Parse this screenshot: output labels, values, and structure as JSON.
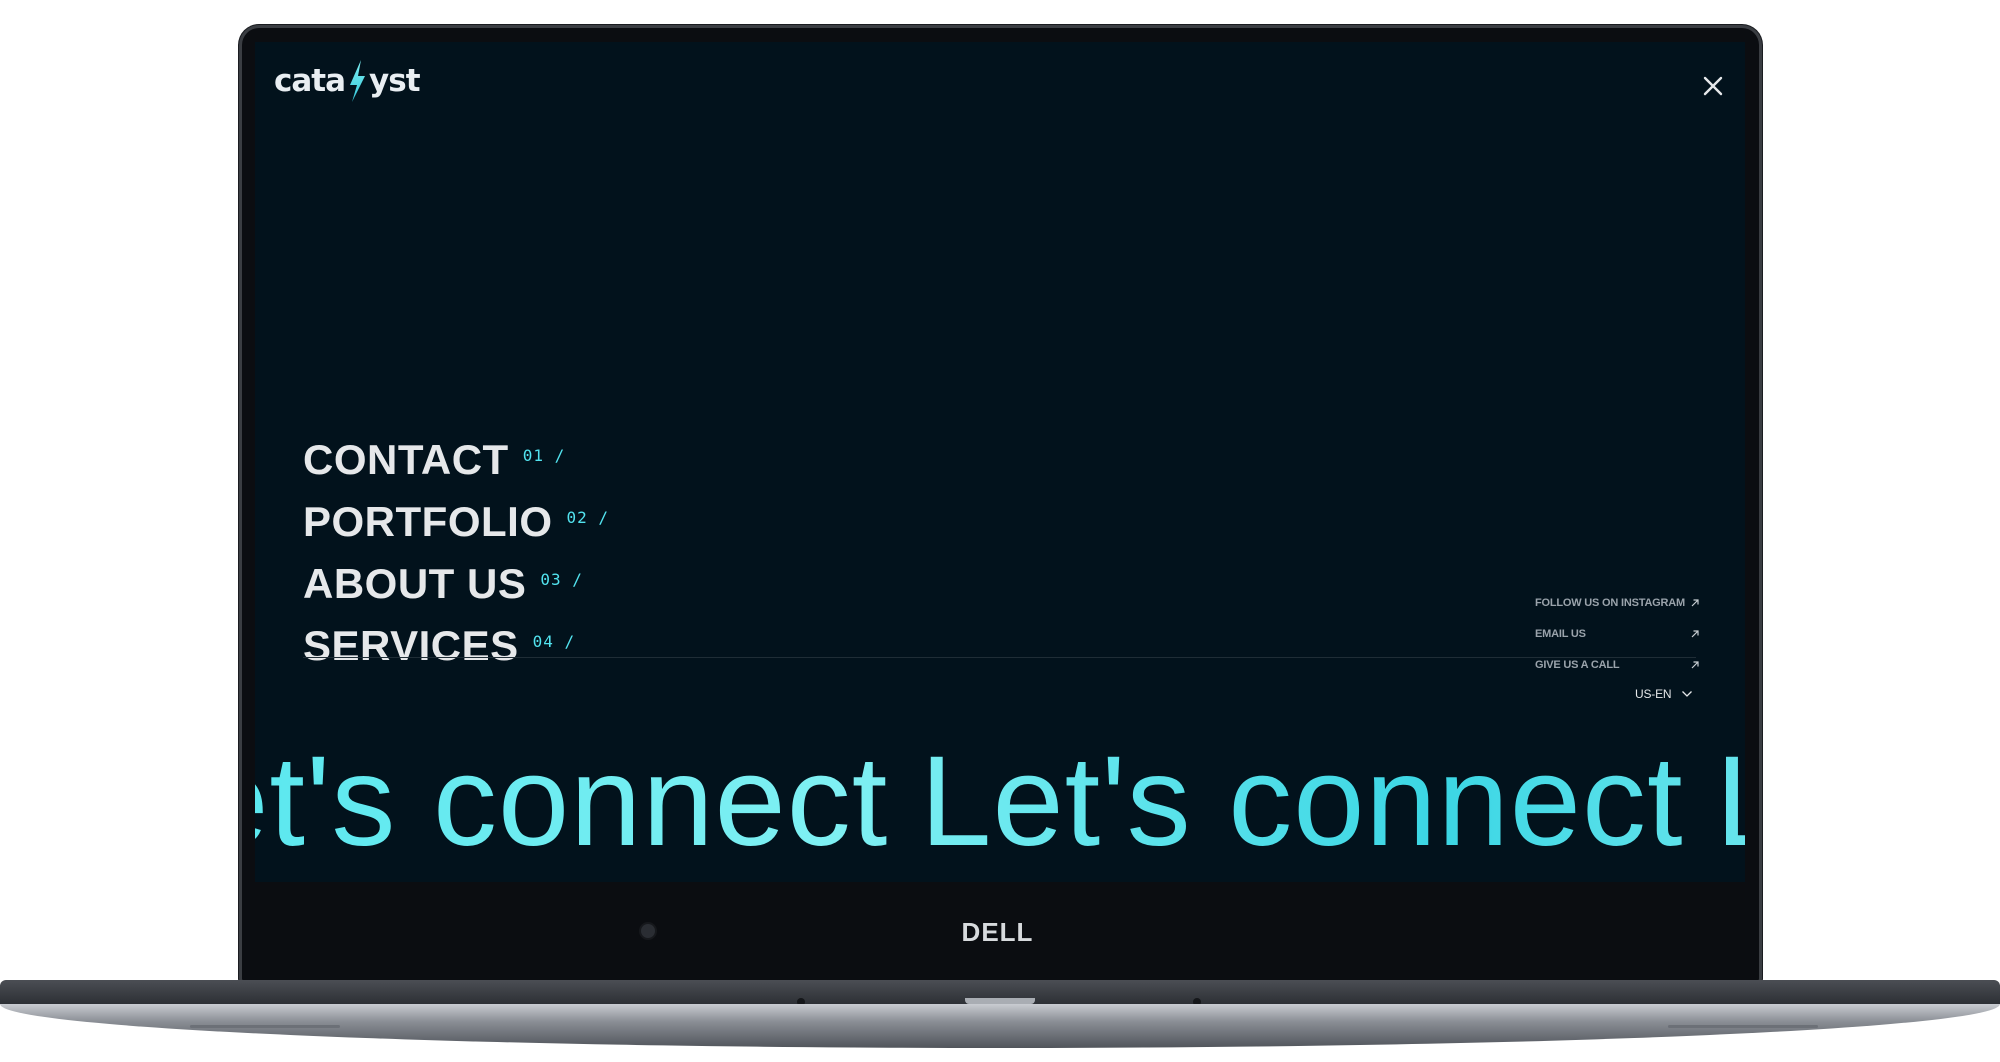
{
  "device": {
    "brand": "DELL"
  },
  "site": {
    "logo_text_before": "cata",
    "logo_text_after": "yst",
    "close_icon": "close-icon"
  },
  "menu": {
    "items": [
      {
        "label": "CONTACT",
        "number": "01 /"
      },
      {
        "label": "PORTFOLIO",
        "number": "02 /"
      },
      {
        "label": "ABOUT US",
        "number": "03 /"
      },
      {
        "label": "SERVICES",
        "number": "04 /"
      }
    ]
  },
  "links": [
    {
      "label": "FOLLOW US ON INSTAGRAM",
      "icon": "arrow-up-right-icon"
    },
    {
      "label": "EMAIL US",
      "icon": "arrow-up-right-icon"
    },
    {
      "label": "GIVE US A CALL",
      "icon": "arrow-up-right-icon"
    }
  ],
  "language": {
    "selected": "US-EN",
    "icon": "chevron-down-icon"
  },
  "marquee": {
    "text": "Let's connect"
  },
  "colors": {
    "background": "#02121c",
    "accent": "#52e3ef",
    "text": "#e6e8ea"
  }
}
